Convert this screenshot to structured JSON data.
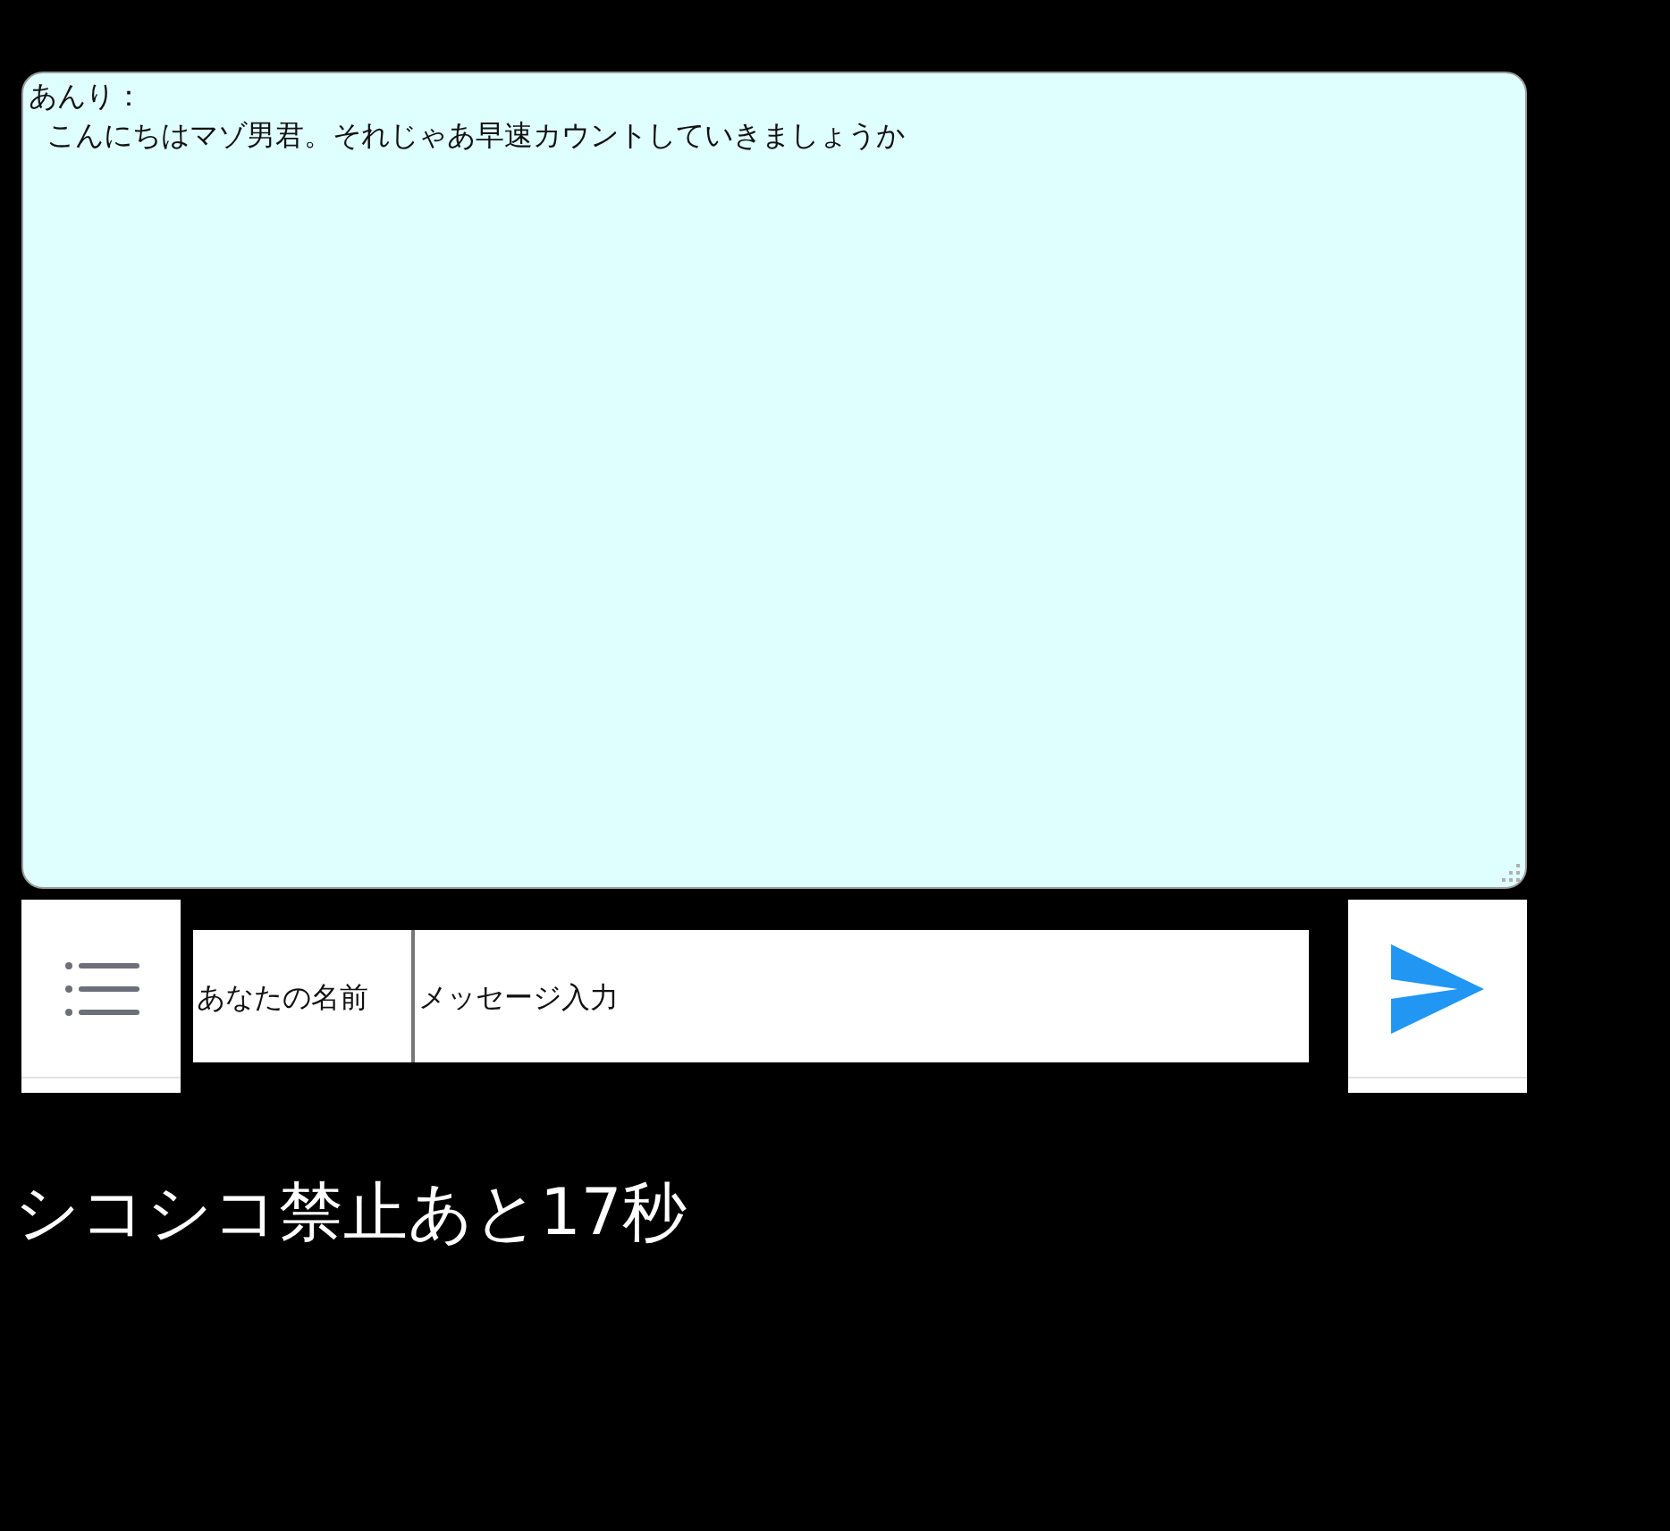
{
  "chat_log": {
    "messages": [
      {
        "speaker": "あんり：",
        "text": "こんにちはマゾ男君。それじゃあ早速カウントしていきましょうか"
      }
    ]
  },
  "input_bar": {
    "name_field": {
      "placeholder": "あなたの名前"
    },
    "message_field": {
      "placeholder": "メッセージ入力"
    }
  },
  "countdown": "シコシコ禁止あと17秒"
}
